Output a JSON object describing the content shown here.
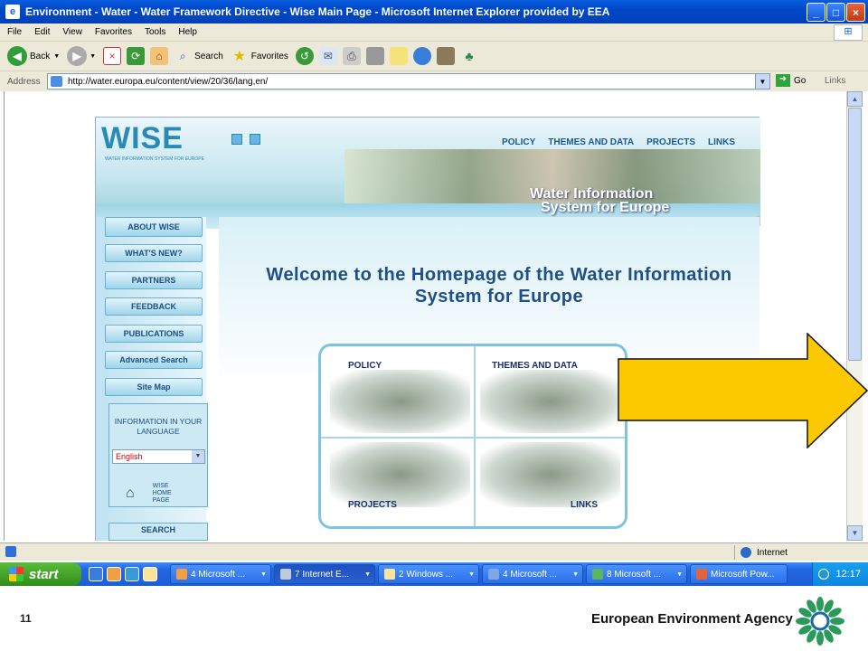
{
  "window": {
    "title": "Environment - Water - Water Framework Directive - Wise Main Page - Microsoft Internet Explorer provided by EEA"
  },
  "menu": [
    "File",
    "Edit",
    "View",
    "Favorites",
    "Tools",
    "Help"
  ],
  "toolbar": {
    "back_label": "Back",
    "search_label": "Search",
    "favorites_label": "Favorites"
  },
  "address": {
    "label": "Address",
    "url": "http://water.europa.eu/content/view/20/36/lang,en/",
    "go_label": "Go",
    "links_label": "Links"
  },
  "page": {
    "logo": "WISE",
    "logo_sub": "WATER INFORMATION SYSTEM FOR EUROPE",
    "top_nav": [
      "POLICY",
      "THEMES AND DATA",
      "PROJECTS",
      "LINKS"
    ],
    "banner_title_1": "Water Information",
    "banner_title_2": "System for Europe",
    "side_nav": [
      "ABOUT WISE",
      "WHAT'S NEW?",
      "PARTNERS",
      "FEEDBACK",
      "PUBLICATIONS",
      "Advanced Search",
      "Site Map"
    ],
    "language_title": "INFORMATION IN YOUR LANGUAGE",
    "language_selected": "English",
    "home_label": "WISE HOME PAGE",
    "search_title": "SEARCH",
    "welcome": "Welcome to the Homepage of the Water Information System for Europe",
    "panels": [
      "POLICY",
      "THEMES AND DATA",
      "PROJECTS",
      "LINKS"
    ]
  },
  "status": {
    "zone": "Internet"
  },
  "taskbar": {
    "start": "start",
    "items": [
      "4 Microsoft ...",
      "7 Internet E...",
      "2 Windows ...",
      "4 Microsoft ...",
      "8 Microsoft ...",
      "Microsoft Pow..."
    ],
    "clock": "12:17"
  },
  "slide": {
    "number": "11",
    "brand": "European Environment Agency"
  },
  "colors": {
    "arrow": "#fcc800",
    "titlebar": "#0a5de0",
    "wise_blue": "#2a8ab6"
  }
}
